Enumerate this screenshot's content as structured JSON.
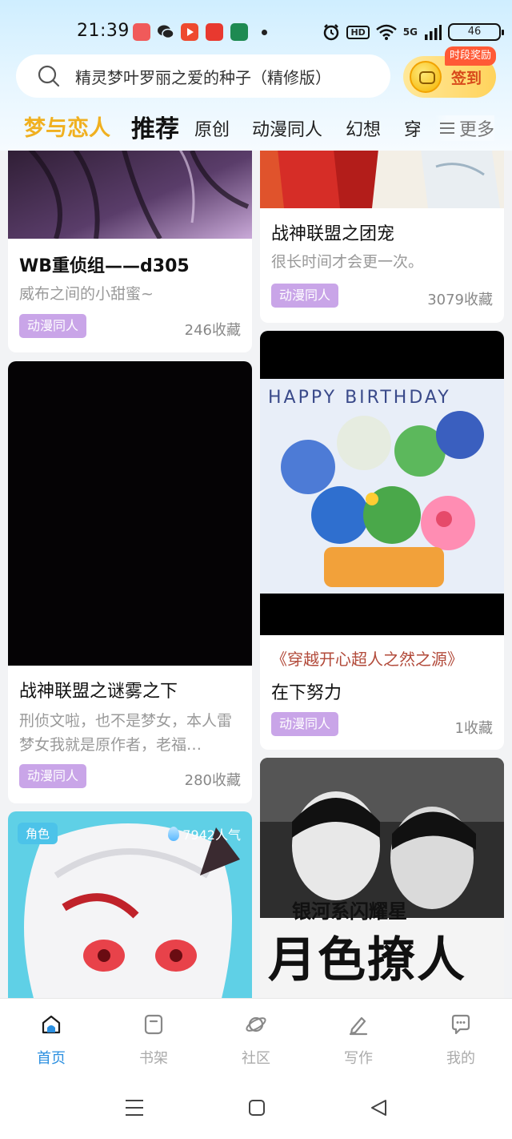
{
  "status_bar": {
    "time": "21:39",
    "hd": "HD",
    "network": "5G",
    "battery": "46",
    "app_icon_colors": [
      "#f05a5a",
      "#3b3b3b",
      "#ee4a2f",
      "#e8392f",
      "#1e8a52"
    ]
  },
  "search": {
    "placeholder": "精灵梦叶罗丽之爱的种子（精修版）",
    "icon": "search-icon"
  },
  "signin": {
    "badge": "时段奖励",
    "label": "签到",
    "icon": "coin-chat-icon"
  },
  "tabs": {
    "brand": "梦与恋人",
    "items": [
      "推荐",
      "原创",
      "动漫同人",
      "幻想",
      "穿"
    ],
    "active": "推荐",
    "more": "更多"
  },
  "colors": {
    "brand": "#f0b020",
    "accent": "#2b8fe0",
    "tag_bg": "#c9a5e8",
    "role_badge": "#4cc3e9"
  },
  "cards": {
    "c1": {
      "title": "WB重侦组——d305",
      "desc": "威布之间的小甜蜜~",
      "tag": "动漫同人",
      "favorites": "246收藏"
    },
    "c2": {
      "title": "战神联盟之团宠",
      "desc": "很长时间才会更一次。",
      "tag": "动漫同人",
      "favorites": "3079收藏"
    },
    "c3": {
      "title": "战神联盟之谜雾之下",
      "desc": "刑侦文啦，也不是梦女，本人雷梦女我就是原作者，老福…",
      "tag": "动漫同人",
      "favorites": "280收藏"
    },
    "c4": {
      "image_text": "HAPPY BIRTHDAY",
      "quote": "《穿越开心超人之然之源》",
      "title": "在下努力",
      "tag": "动漫同人",
      "favorites": "1收藏"
    },
    "c5": {
      "role_badge": "角色",
      "popularity": "7942人气"
    },
    "c6": {
      "overlay_line1": "银河系闪耀星",
      "overlay_line2": "月色撩人"
    }
  },
  "bottom_nav": {
    "items": [
      {
        "label": "首页",
        "icon": "home-icon"
      },
      {
        "label": "书架",
        "icon": "bookshelf-icon"
      },
      {
        "label": "社区",
        "icon": "planet-icon"
      },
      {
        "label": "写作",
        "icon": "pen-icon"
      },
      {
        "label": "我的",
        "icon": "chat-bubble-icon"
      }
    ],
    "active": "首页"
  }
}
